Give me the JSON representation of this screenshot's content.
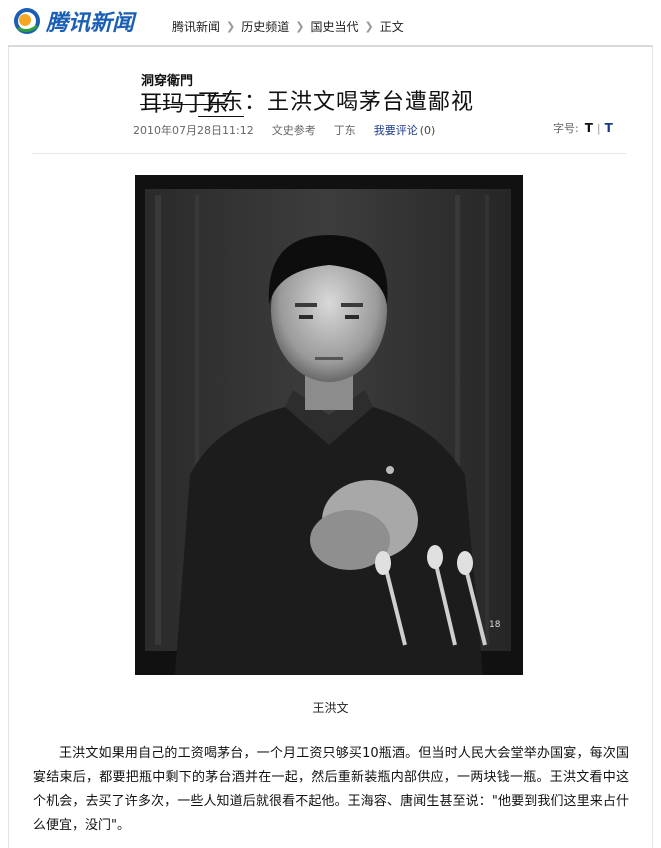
{
  "header": {
    "logo_text": "腾讯新闻",
    "breadcrumb": [
      "腾讯新闻",
      "历史频道",
      "国史当代",
      "正文"
    ]
  },
  "column": {
    "sign": "洞穿衛門",
    "name": "耳玛丁东"
  },
  "article": {
    "title_author": "丁东",
    "title_rest": "：王洪文喝茅台遭鄙视",
    "date": "2010年07月28日11:12",
    "source": "文史参考",
    "author": "丁东",
    "comment_label": "我要评论",
    "comment_count": "(0)",
    "font_label": "字号:",
    "font_big": "T",
    "font_sep": "|",
    "font_small": "T",
    "caption": "王洪文",
    "body": "王洪文如果用自己的工资喝茅台，一个月工资只够买10瓶酒。但当时人民大会堂举办国宴，每次国宴结束后，都要把瓶中剩下的茅台酒并在一起，然后重新装瓶内部供应，一两块钱一瓶。王洪文看中这个机会，去买了许多次，一些人知道后就很看不起他。王海容、唐闻生甚至说：\"他要到我们这里来占什么便宜，没门\"。"
  },
  "photo": {
    "subject": "black-and-white portrait photo",
    "corner_mark": "18"
  },
  "colors": {
    "brand_blue": "#1a5fb4",
    "logo_orange": "#f5a623",
    "link_navy": "#1a3a8a"
  }
}
